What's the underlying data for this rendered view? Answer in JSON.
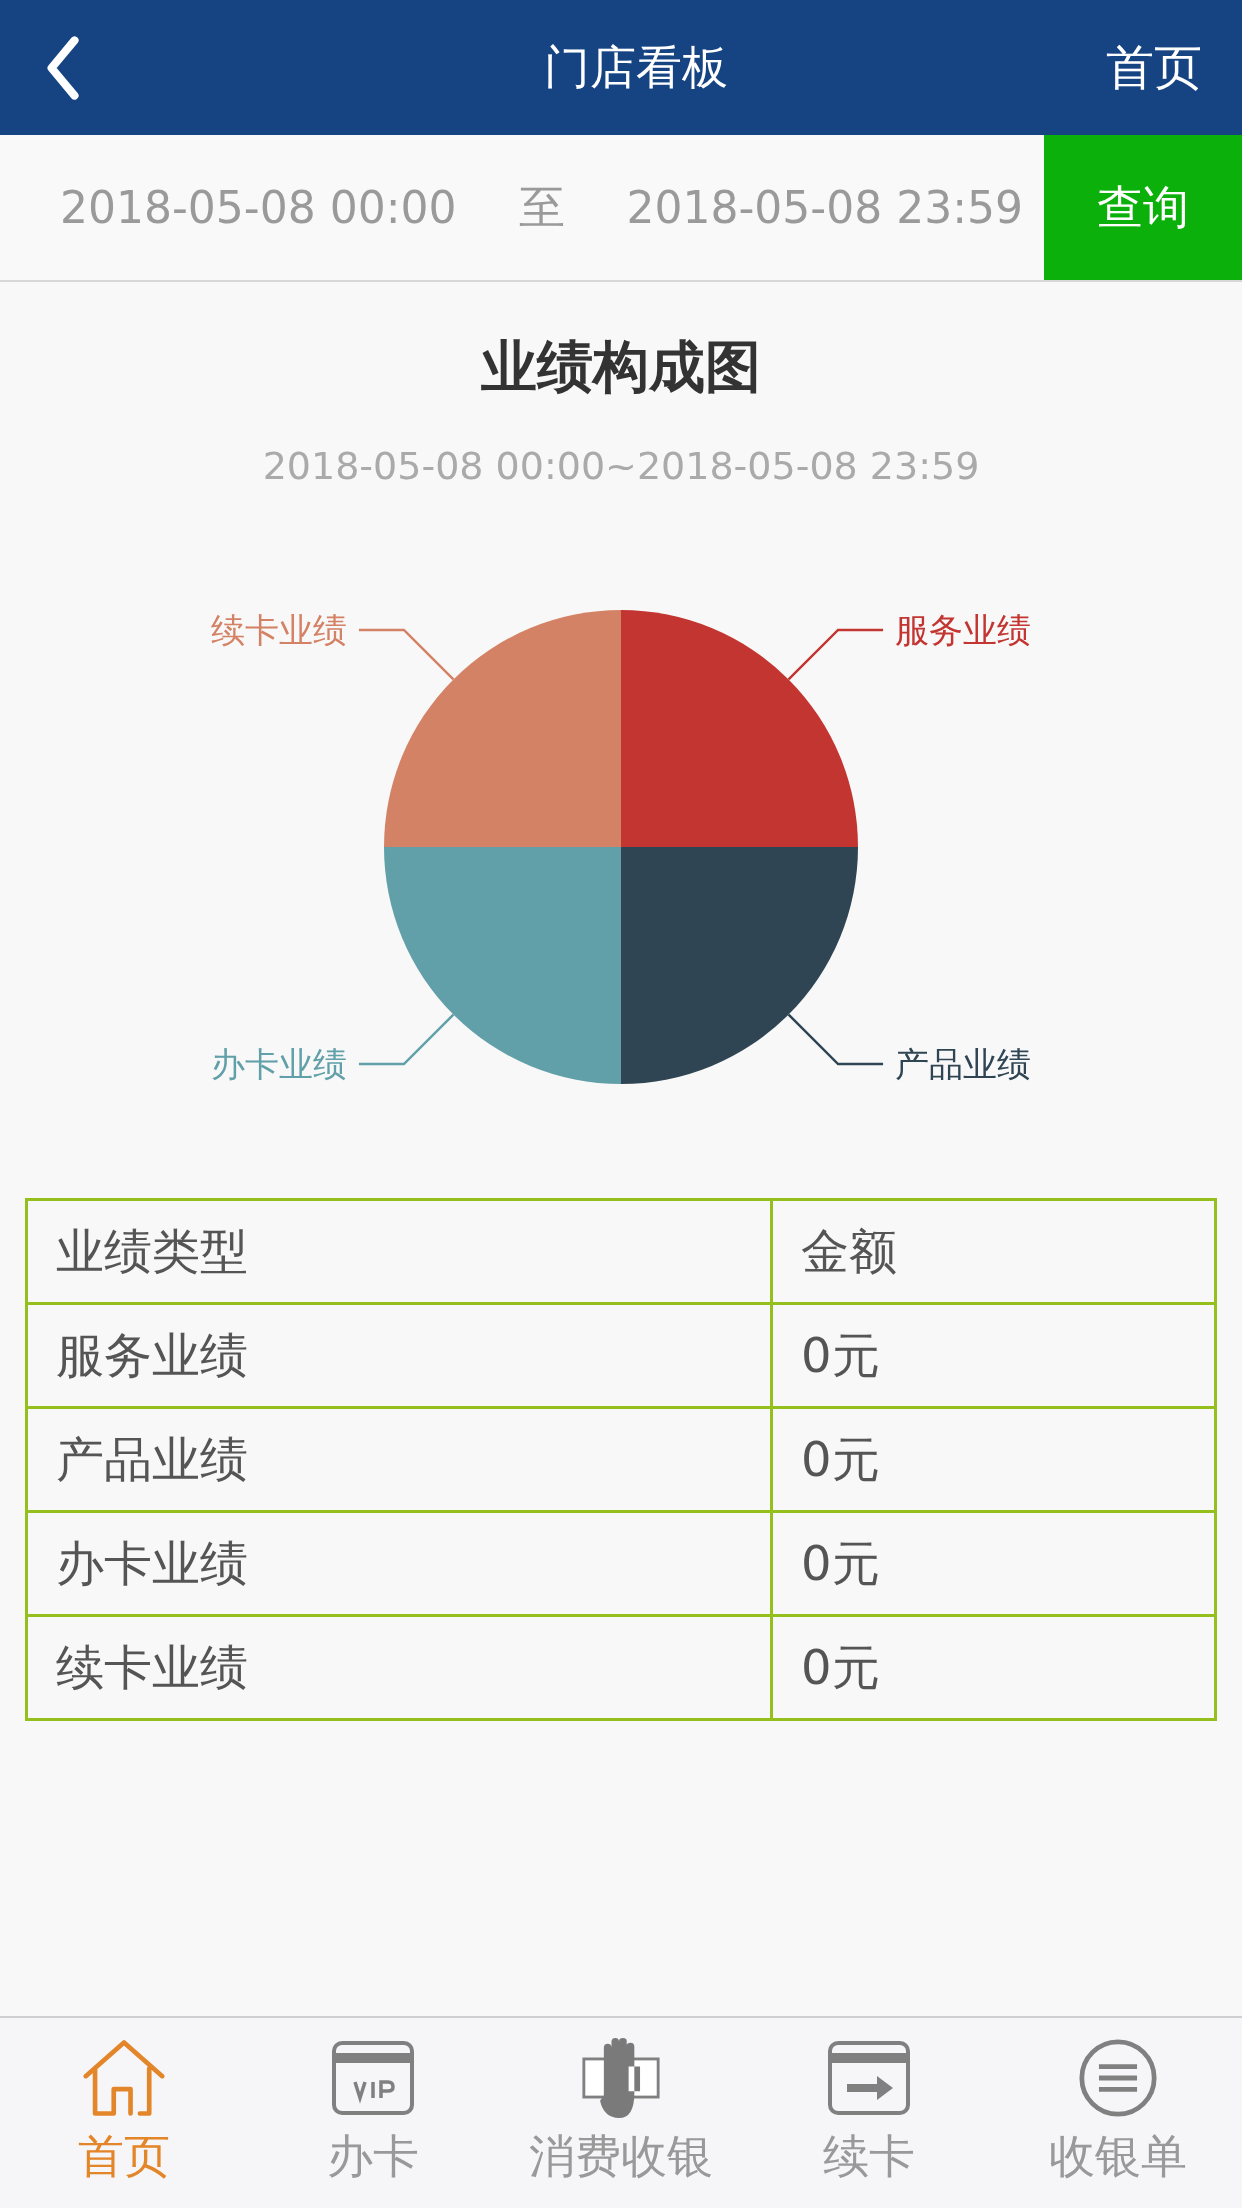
{
  "header": {
    "title": "门店看板",
    "home_link": "首页"
  },
  "filter": {
    "start": "2018-05-08 00:00",
    "separator": "至",
    "end": "2018-05-08 23:59",
    "query_button": "查询"
  },
  "chart": {
    "title": "业绩构成图",
    "subtitle": "2018-05-08 00:00~2018-05-08 23:59",
    "chart_data": {
      "type": "pie",
      "categories": [
        "服务业绩",
        "产品业绩",
        "办卡业绩",
        "续卡业绩"
      ],
      "values": [
        25,
        25,
        25,
        25
      ],
      "colors": [
        "#c23531",
        "#2f4554",
        "#61a0a8",
        "#d48265"
      ]
    }
  },
  "table": {
    "columns": [
      "业绩类型",
      "金额"
    ],
    "rows": [
      [
        "服务业绩",
        "0元"
      ],
      [
        "产品业绩",
        "0元"
      ],
      [
        "办卡业绩",
        "0元"
      ],
      [
        "续卡业绩",
        "0元"
      ]
    ]
  },
  "bottom_nav": [
    {
      "kind": "home",
      "label": "首页",
      "selected": true
    },
    {
      "kind": "vip",
      "label": "办卡",
      "selected": false
    },
    {
      "kind": "cash",
      "label": "消费收银",
      "selected": false
    },
    {
      "kind": "renew",
      "label": "续卡",
      "selected": false
    },
    {
      "kind": "list",
      "label": "收银单",
      "selected": false
    }
  ]
}
